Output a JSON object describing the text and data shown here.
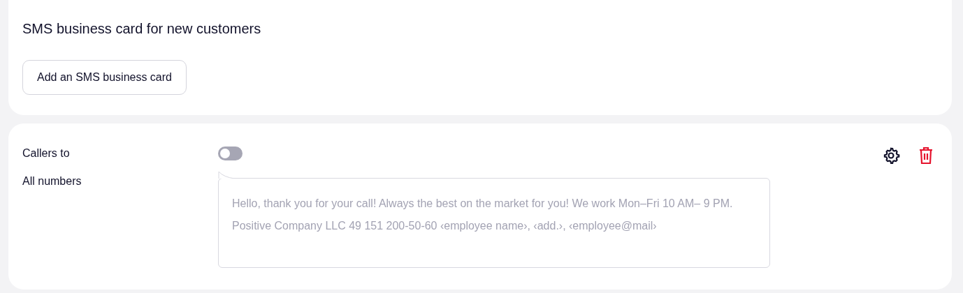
{
  "top_card": {
    "title": "SMS business card for new customers",
    "button": "Add an SMS business card"
  },
  "card": {
    "callers_label": "Callers to",
    "numbers_label": "All numbers",
    "toggle": {
      "on": false
    },
    "message": {
      "placeholder": "Hello, thank you for your call! Always the best on the market for you! We work Mon–Fri 10 AM– 9 PM. Positive Company LLC 49 151 200-50-60 ‹employee name›, ‹add.›, ‹employee@mail›"
    }
  }
}
